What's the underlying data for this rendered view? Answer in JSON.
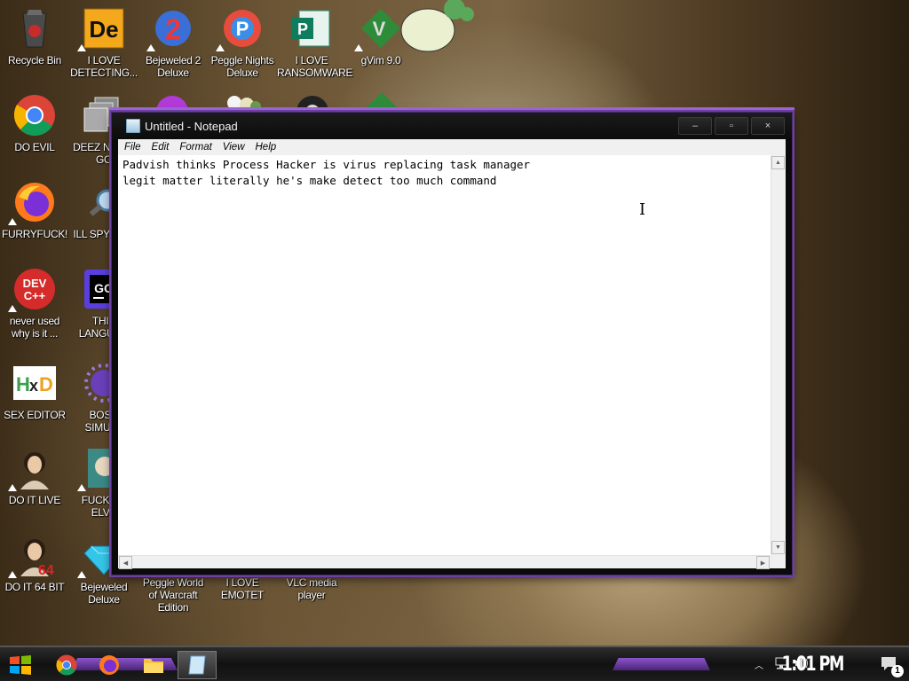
{
  "desktop": {
    "icons": [
      {
        "label": "Recycle Bin"
      },
      {
        "label": "I LOVE DETECTING..."
      },
      {
        "label": "Bejeweled 2 Deluxe"
      },
      {
        "label": "Peggle Nights Deluxe"
      },
      {
        "label": "I LOVE RANSOMWARE"
      },
      {
        "label": "gVim 9.0"
      },
      {
        "label": "DO EVIL"
      },
      {
        "label": "DEEZ N HAH GO"
      },
      {
        "label": "FURRYFUCK!"
      },
      {
        "label": "ILL SPY YOU"
      },
      {
        "label": "never used why is it ..."
      },
      {
        "label": "THIS LANGUAG"
      },
      {
        "label": "SEX EDITOR"
      },
      {
        "label": "BOSN SIMULA"
      },
      {
        "label": "DO IT LIVE"
      },
      {
        "label": "FUCK SC ELVE"
      },
      {
        "label": "DO IT 64 BIT"
      },
      {
        "label": "Bejeweled Deluxe"
      },
      {
        "label": "Peggle World of Warcraft Edition"
      },
      {
        "label": "I LOVE EMOTET"
      },
      {
        "label": "VLC media player"
      }
    ]
  },
  "notepad": {
    "title": "Untitled - Notepad",
    "controls": {
      "minimize": "–",
      "maximize": "▫",
      "close": "×"
    },
    "menu": [
      "File",
      "Edit",
      "Format",
      "View",
      "Help"
    ],
    "content": "Padvish thinks Process Hacker is virus replacing task manager\nlegit matter literally he's make detect too much command"
  },
  "taskbar": {
    "clock": "1:01 PM",
    "notification_count": "1",
    "colors": {
      "accent": "#8a55c9"
    }
  }
}
